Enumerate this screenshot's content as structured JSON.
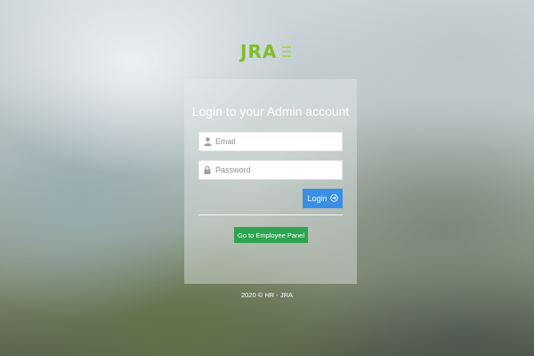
{
  "brand": {
    "logo_text": "JRA",
    "accent_color": "#7fbf2a"
  },
  "login_panel": {
    "title": "Login to your Admin account",
    "email": {
      "placeholder": "Email",
      "value": "",
      "icon": "user-icon"
    },
    "password": {
      "placeholder": "Password",
      "value": "",
      "icon": "lock-icon"
    },
    "login_button": {
      "label": "Login",
      "icon": "arrow-circle-right-icon",
      "color": "#3a8ee6"
    },
    "employee_button": {
      "label": "Go to Employee Panel",
      "color": "#2ea44f"
    }
  },
  "footer": {
    "text": "2020 © HR - JRA"
  }
}
